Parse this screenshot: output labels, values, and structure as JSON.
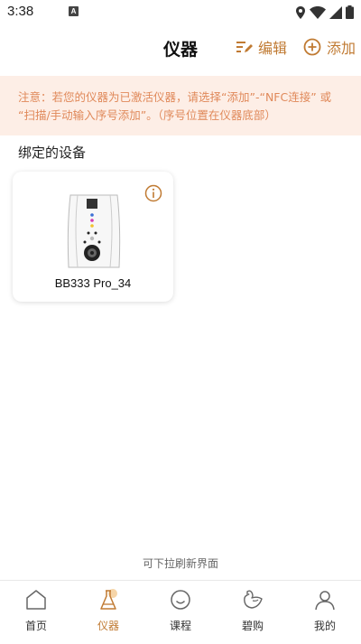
{
  "status_bar": {
    "time": "3:38",
    "notification_badge": "A"
  },
  "header": {
    "title": "仪器",
    "edit_label": "编辑",
    "add_label": "添加"
  },
  "notice": {
    "text_line1": "注意：若您的仪器为已激活仪器，请选择“添加”-“NFC连接” 或",
    "text_line2": "“扫描/手动输入序号添加”。（序号位置在仪器底部）"
  },
  "section": {
    "title": "绑定的设备"
  },
  "devices": [
    {
      "name": "BB333 Pro_34"
    }
  ],
  "pull_hint": "可下拉刷新界面",
  "bottom_nav": {
    "items": [
      {
        "label": "首页",
        "icon": "home-icon"
      },
      {
        "label": "仪器",
        "icon": "flask-icon"
      },
      {
        "label": "课程",
        "icon": "smile-icon"
      },
      {
        "label": "碧购",
        "icon": "bird-icon"
      },
      {
        "label": "我的",
        "icon": "person-icon"
      }
    ],
    "active_index": 1
  },
  "colors": {
    "accent": "#c07a32",
    "notice_bg": "#fdeee6",
    "notice_text": "#e0895a"
  }
}
